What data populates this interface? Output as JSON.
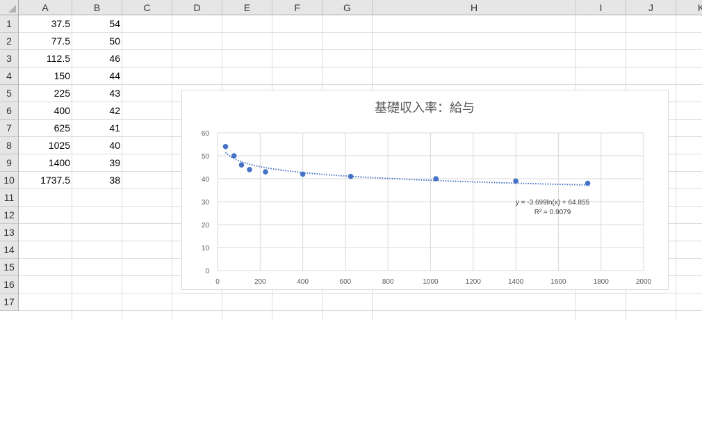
{
  "sheet": {
    "columns": [
      "A",
      "B",
      "C",
      "D",
      "E",
      "F",
      "G",
      "H",
      "I",
      "J",
      "K"
    ],
    "rows": [
      "1",
      "2",
      "3",
      "4",
      "5",
      "6",
      "7",
      "8",
      "9",
      "10",
      "11",
      "12",
      "13",
      "14",
      "15",
      "16",
      "17"
    ],
    "cells": [
      {
        "a": "37.5",
        "b": "54"
      },
      {
        "a": "77.5",
        "b": "50"
      },
      {
        "a": "112.5",
        "b": "46"
      },
      {
        "a": "150",
        "b": "44"
      },
      {
        "a": "225",
        "b": "43"
      },
      {
        "a": "400",
        "b": "42"
      },
      {
        "a": "625",
        "b": "41"
      },
      {
        "a": "1025",
        "b": "40"
      },
      {
        "a": "1400",
        "b": "39"
      },
      {
        "a": "1737.5",
        "b": "38"
      }
    ]
  },
  "chart_data": {
    "type": "scatter",
    "title": "基礎収入率：給与",
    "xlabel": "",
    "ylabel": "",
    "xlim": [
      0,
      2000
    ],
    "ylim": [
      0,
      60
    ],
    "xticks": [
      "0",
      "200",
      "400",
      "600",
      "800",
      "1000",
      "1200",
      "1400",
      "1600",
      "1800",
      "2000"
    ],
    "yticks": [
      "0",
      "10",
      "20",
      "30",
      "40",
      "50",
      "60"
    ],
    "grid": true,
    "series": [
      {
        "x": [
          37.5,
          77.5,
          112.5,
          150,
          225,
          400,
          625,
          1025,
          1400,
          1737.5
        ],
        "y": [
          54,
          50,
          46,
          44,
          43,
          42,
          41,
          40,
          39,
          38
        ],
        "color": "#4472c4"
      }
    ],
    "trendline": {
      "type": "logarithmic",
      "a": -3.699,
      "b": 64.855,
      "equation": "y = -3.699ln(x) + 64.855",
      "r2_label": "R² = 0.9079",
      "color": "#4472c4"
    }
  }
}
